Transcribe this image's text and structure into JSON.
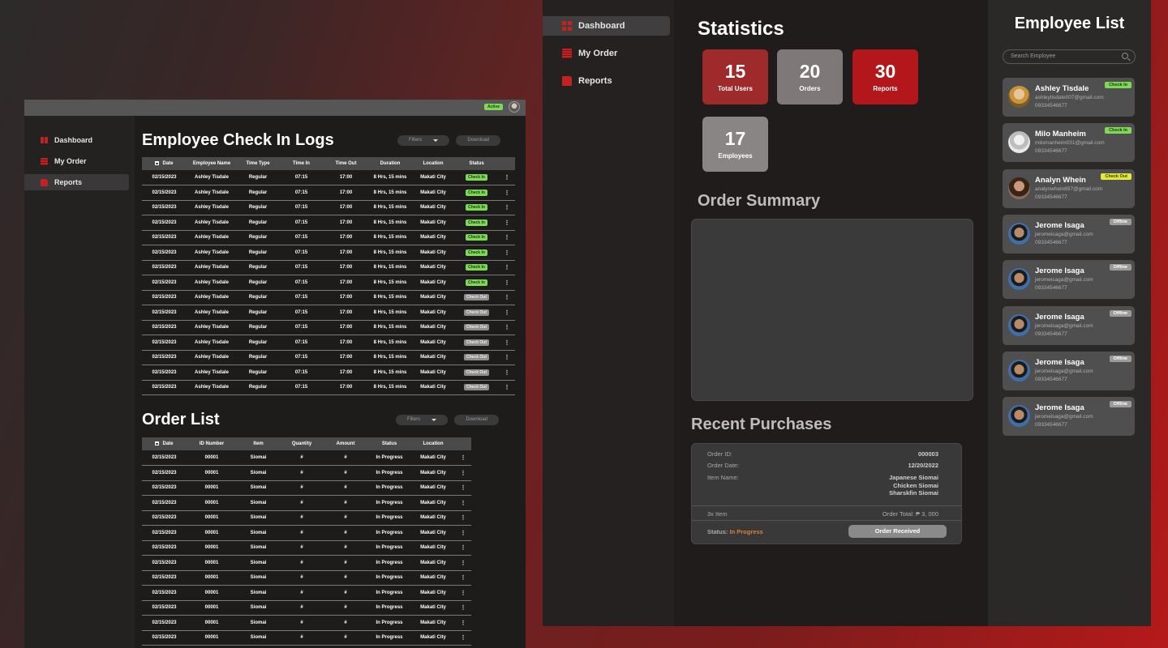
{
  "left_window": {
    "status_badge": "Active",
    "nav": [
      {
        "label": "Dashboard",
        "icon": "dashboard-icon"
      },
      {
        "label": "My Order",
        "icon": "order-icon"
      },
      {
        "label": "Reports",
        "icon": "folder-icon"
      }
    ],
    "checkin": {
      "title": "Employee Check In Logs",
      "filters_label": "Filters",
      "download_label": "Download",
      "columns": [
        "Date",
        "Employee Name",
        "Time Type",
        "Time In",
        "Time Out",
        "Duration",
        "Location",
        "Status"
      ],
      "rows": [
        [
          "02/15/2023",
          "Ashley Tisdale",
          "Regular",
          "07:15",
          "17:00",
          "8 Hrs, 15 mins",
          "Makati City",
          "Check In"
        ],
        [
          "02/15/2023",
          "Ashley Tisdale",
          "Regular",
          "07:15",
          "17:00",
          "8 Hrs, 15 mins",
          "Makati City",
          "Check In"
        ],
        [
          "02/15/2023",
          "Ashley Tisdale",
          "Regular",
          "07:15",
          "17:00",
          "8 Hrs, 15 mins",
          "Makati City",
          "Check In"
        ],
        [
          "02/15/2023",
          "Ashley Tisdale",
          "Regular",
          "07:15",
          "17:00",
          "8 Hrs, 15 mins",
          "Makati City",
          "Check In"
        ],
        [
          "02/15/2023",
          "Ashley Tisdale",
          "Regular",
          "07:15",
          "17:00",
          "8 Hrs, 15 mins",
          "Makati City",
          "Check In"
        ],
        [
          "02/15/2023",
          "Ashley Tisdale",
          "Regular",
          "07:15",
          "17:00",
          "8 Hrs, 15 mins",
          "Makati City",
          "Check In"
        ],
        [
          "02/15/2023",
          "Ashley Tisdale",
          "Regular",
          "07:15",
          "17:00",
          "8 Hrs, 15 mins",
          "Makati City",
          "Check In"
        ],
        [
          "02/15/2023",
          "Ashley Tisdale",
          "Regular",
          "07:15",
          "17:00",
          "8 Hrs, 15 mins",
          "Makati City",
          "Check In"
        ],
        [
          "02/15/2023",
          "Ashley Tisdale",
          "Regular",
          "07:15",
          "17:00",
          "8 Hrs, 15 mins",
          "Makati City",
          "Check Out"
        ],
        [
          "02/15/2023",
          "Ashley Tisdale",
          "Regular",
          "07:15",
          "17:00",
          "8 Hrs, 15 mins",
          "Makati City",
          "Check Out"
        ],
        [
          "02/15/2023",
          "Ashley Tisdale",
          "Regular",
          "07:15",
          "17:00",
          "8 Hrs, 15 mins",
          "Makati City",
          "Check Out"
        ],
        [
          "02/15/2023",
          "Ashley Tisdale",
          "Regular",
          "07:15",
          "17:00",
          "8 Hrs, 15 mins",
          "Makati City",
          "Check Out"
        ],
        [
          "02/15/2023",
          "Ashley Tisdale",
          "Regular",
          "07:15",
          "17:00",
          "8 Hrs, 15 mins",
          "Makati City",
          "Check Out"
        ],
        [
          "02/15/2023",
          "Ashley Tisdale",
          "Regular",
          "07:15",
          "17:00",
          "8 Hrs, 15 mins",
          "Makati City",
          "Check Out"
        ],
        [
          "02/15/2023",
          "Ashley Tisdale",
          "Regular",
          "07:15",
          "17:00",
          "8 Hrs, 15 mins",
          "Makati City",
          "Check Out"
        ]
      ]
    },
    "orders": {
      "title": "Order List",
      "filters_label": "Filters",
      "download_label": "Download",
      "columns": [
        "Date",
        "ID Number",
        "Item",
        "Quantity",
        "Amount",
        "Status",
        "Location"
      ],
      "rows": [
        [
          "02/15/2023",
          "00001",
          "Siomai",
          "#",
          "#",
          "In Progress",
          "Makati City"
        ],
        [
          "02/15/2023",
          "00001",
          "Siomai",
          "#",
          "#",
          "In Progress",
          "Makati City"
        ],
        [
          "02/15/2023",
          "00001",
          "Siomai",
          "#",
          "#",
          "In Progress",
          "Makati City"
        ],
        [
          "02/15/2023",
          "00001",
          "Siomai",
          "#",
          "#",
          "In Progress",
          "Makati City"
        ],
        [
          "02/15/2023",
          "00001",
          "Siomai",
          "#",
          "#",
          "In Progress",
          "Makati City"
        ],
        [
          "02/15/2023",
          "00001",
          "Siomai",
          "#",
          "#",
          "In Progress",
          "Makati City"
        ],
        [
          "02/15/2023",
          "00001",
          "Siomai",
          "#",
          "#",
          "In Progress",
          "Makati City"
        ],
        [
          "02/15/2023",
          "00001",
          "Siomai",
          "#",
          "#",
          "In Progress",
          "Makati City"
        ],
        [
          "02/15/2023",
          "00001",
          "Siomai",
          "#",
          "#",
          "In Progress",
          "Makati City"
        ],
        [
          "02/15/2023",
          "00001",
          "Siomai",
          "#",
          "#",
          "In Progress",
          "Makati City"
        ],
        [
          "02/15/2023",
          "00001",
          "Siomai",
          "#",
          "#",
          "In Progress",
          "Makati City"
        ],
        [
          "02/15/2023",
          "00001",
          "Siomai",
          "#",
          "#",
          "In Progress",
          "Makati City"
        ],
        [
          "02/15/2023",
          "00001",
          "Siomai",
          "#",
          "#",
          "In Progress",
          "Makati City"
        ]
      ]
    }
  },
  "right_window": {
    "nav": [
      {
        "label": "Dashboard",
        "icon": "dashboard-icon"
      },
      {
        "label": "My Order",
        "icon": "order-icon"
      },
      {
        "label": "Reports",
        "icon": "folder-icon"
      }
    ],
    "statistics_title": "Statistics",
    "stats": [
      {
        "value": "15",
        "label": "Total Users",
        "color": "#9e2a2b"
      },
      {
        "value": "20",
        "label": "Orders",
        "color": "#7e7878"
      },
      {
        "value": "30",
        "label": "Reports",
        "color": "#b3161b"
      },
      {
        "value": "17",
        "label": "Employees",
        "color": "#8a8585"
      }
    ],
    "order_summary_title": "Order Summary",
    "recent_title": "Recent Purchases",
    "purchase": {
      "order_id_label": "Order ID:",
      "order_id": "000003",
      "order_date_label": "Order Date:",
      "order_date": "12/20/2022",
      "item_name_label": "Item Name:",
      "items": [
        "Japanese Siomai",
        "Chicken Siomai",
        "Sharskfin Siomai"
      ],
      "item_count": "3x Item",
      "order_total": "Order Total: ₱ 3, 000",
      "status_label": "Status:",
      "status_value": "In Progress",
      "status_color": "#d9803a",
      "button_label": "Order Received"
    },
    "employee_list": {
      "title": "Employee List",
      "search_placeholder": "Search Employee",
      "employees": [
        {
          "name": "Ashley Tisdale",
          "email": "ashleytisdale007@gmail.com",
          "phone": "09334546677",
          "status": "Check In",
          "status_type": "in"
        },
        {
          "name": "Milo Manheim",
          "email": "milomanheim031@gmail.com",
          "phone": "09334546677",
          "status": "Check In",
          "status_type": "in"
        },
        {
          "name": "Analyn Whein",
          "email": "analynwhein897@gmail.com",
          "phone": "09334546677",
          "status": "Check Out",
          "status_type": "out"
        },
        {
          "name": "Jerome Isaga",
          "email": "jeromeisaga@gmail.com",
          "phone": "09334546677",
          "status": "Offline",
          "status_type": "off"
        },
        {
          "name": "Jerome Isaga",
          "email": "jeromeisaga@gmail.com",
          "phone": "09334546677",
          "status": "Offline",
          "status_type": "off"
        },
        {
          "name": "Jerome Isaga",
          "email": "jeromeisaga@gmail.com",
          "phone": "09334546677",
          "status": "Offline",
          "status_type": "off"
        },
        {
          "name": "Jerome Isaga",
          "email": "jeromeisaga@gmail.com",
          "phone": "09334546677",
          "status": "Offline",
          "status_type": "off"
        },
        {
          "name": "Jerome Isaga",
          "email": "jeromeisaga@gmail.com",
          "phone": "09334546677",
          "status": "Offline",
          "status_type": "off"
        }
      ]
    }
  }
}
